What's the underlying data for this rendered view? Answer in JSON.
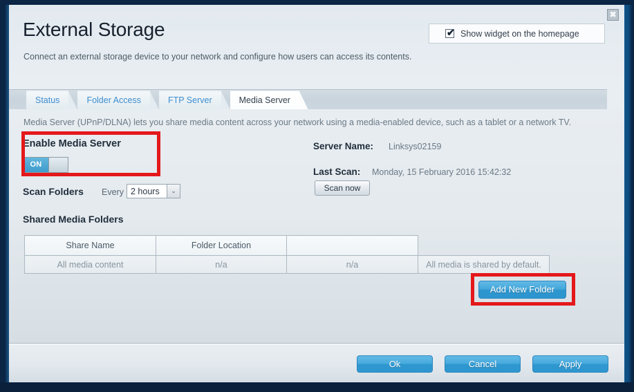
{
  "window": {
    "close_icon": "✖"
  },
  "header": {
    "title": "External Storage",
    "subtitle": "Connect an external storage device to your network and configure how users can access its contents.",
    "widget_checkbox_label": "Show widget on the homepage",
    "widget_checkbox_checked": true,
    "widget_check_glyph": "✔"
  },
  "tabs": [
    {
      "label": "Status",
      "active": false
    },
    {
      "label": "Folder Access",
      "active": false
    },
    {
      "label": "FTP Server",
      "active": false
    },
    {
      "label": "Media Server",
      "active": true
    }
  ],
  "main": {
    "description": "Media Server (UPnP/DLNA) lets you share media content across your network using a media-enabled device, such as a tablet or a network TV.",
    "enable_label": "Enable Media Server",
    "toggle_state": "ON",
    "scan_folders_label": "Scan Folders",
    "scan_every_label": "Every",
    "scan_interval_value": "2 hours",
    "scan_interval_arrow": "⌄",
    "server_name_label": "Server Name:",
    "server_name_value": "Linksys02159",
    "last_scan_label": "Last Scan:",
    "last_scan_value": "Monday, 15 February 2016 15:42:32",
    "scan_now_label": "Scan now",
    "shared_media_title": "Shared Media Folders",
    "add_new_folder_label": "Add New Folder"
  },
  "table": {
    "headers": [
      "Share Name",
      "Folder Location",
      ""
    ],
    "rows": [
      [
        "All media content",
        "n/a",
        "n/a",
        "All media is shared by default."
      ]
    ]
  },
  "footer": {
    "ok_label": "Ok",
    "cancel_label": "Cancel",
    "apply_label": "Apply"
  },
  "colors": {
    "accent_blue": "#2f97d0",
    "highlight_red": "#e4181b",
    "frame_navy": "#0b2545",
    "tab_link": "#3d8ed0"
  }
}
